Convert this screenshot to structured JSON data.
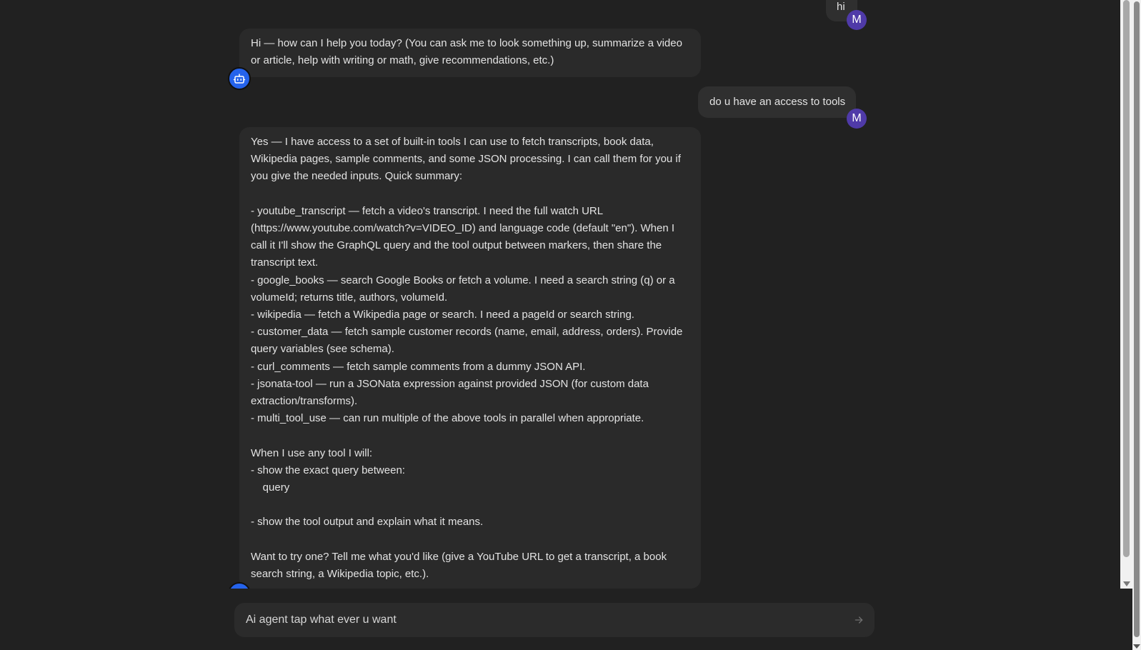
{
  "messages": [
    {
      "role": "user",
      "avatar_initial": "M",
      "lines": [
        "hi"
      ]
    },
    {
      "role": "assistant",
      "avatar_icon": "robot-icon",
      "lines": [
        "Hi — how can I help you today? (You can ask me to look something up, summarize a video",
        "or article, help with writing or math, give recommendations, etc.)"
      ]
    },
    {
      "role": "user",
      "avatar_initial": "M",
      "lines": [
        "do u have an access to tools"
      ]
    },
    {
      "role": "assistant",
      "avatar_icon": "robot-icon",
      "lines": [
        "Yes — I have access to a set of built-in tools I can use to fetch transcripts, book data,",
        "Wikipedia pages, sample comments, and some JSON processing. I can call them for you if",
        "you give the needed inputs. Quick summary:",
        "",
        "- youtube_transcript — fetch a video's transcript. I need the full watch URL",
        "(https://www.youtube.com/watch?v=VIDEO_ID) and language code (default \"en\"). When I",
        "call it I'll show the GraphQL query and the tool output between markers, then share the",
        "transcript text.",
        "- google_books — search Google Books or fetch a volume. I need a search string (q) or a",
        "volumeId; returns title, authors, volumeId.",
        "- wikipedia — fetch a Wikipedia page or search. I need a pageId or search string.",
        "- customer_data — fetch sample customer records (name, email, address, orders). Provide",
        "query variables (see schema).",
        "- curl_comments — fetch sample comments from a dummy JSON API.",
        "- jsonata-tool — run a JSONata expression against provided JSON (for custom data",
        "extraction/transforms).",
        "- multi_tool_use — can run multiple of the above tools in parallel when appropriate.",
        "",
        "When I use any tool I will:",
        "- show the exact query between:",
        "    query",
        "",
        "- show the tool output and explain what it means.",
        "",
        "Want to try one? Tell me what you'd like (give a YouTube URL to get a transcript, a book",
        "search string, a Wikipedia topic, etc.)."
      ]
    }
  ],
  "composer": {
    "placeholder": "Ai agent tap what ever u want",
    "send_icon": "arrow-right-icon"
  },
  "colors": {
    "background": "#212121",
    "assistant_bubble": "#2a2a2a",
    "user_bubble": "#2f2f2f",
    "user_avatar": "#4f3aa8",
    "bot_avatar": "#2563eb"
  }
}
